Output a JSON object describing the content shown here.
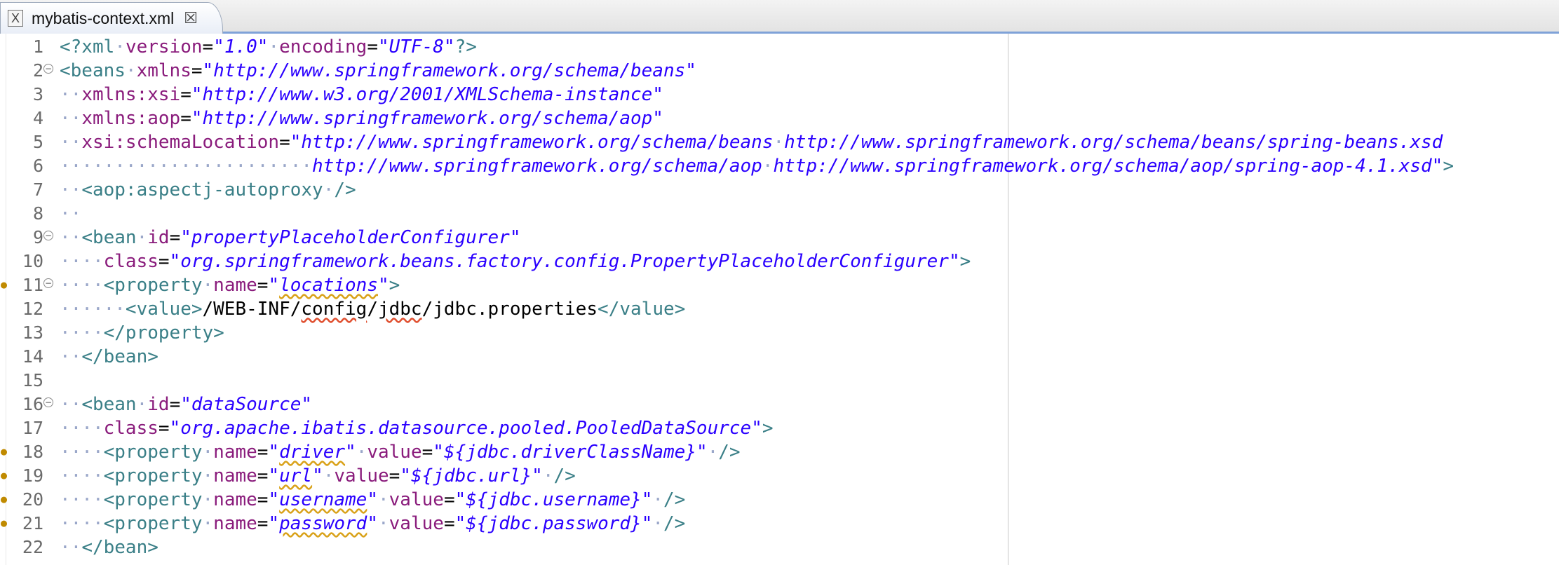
{
  "tab": {
    "title": "mybatis-context.xml",
    "icon": "xml-file-icon",
    "close_icon": "close-icon"
  },
  "editor": {
    "lines": [
      {
        "n": "1",
        "fold": false,
        "marker": false,
        "segs": [
          [
            "pi",
            "<?xml"
          ],
          [
            "d",
            "·"
          ],
          [
            "an",
            "version"
          ],
          [
            "tx",
            "="
          ],
          [
            "av",
            "\"1.0\""
          ],
          [
            "d",
            "·"
          ],
          [
            "an",
            "encoding"
          ],
          [
            "tx",
            "="
          ],
          [
            "av",
            "\"UTF-8\""
          ],
          [
            "pi",
            "?>"
          ]
        ]
      },
      {
        "n": "2",
        "fold": true,
        "marker": false,
        "segs": [
          [
            "tg",
            "<beans"
          ],
          [
            "d",
            "·"
          ],
          [
            "an",
            "xmlns"
          ],
          [
            "tx",
            "="
          ],
          [
            "av",
            "\"http://www.springframework.org/schema/beans\""
          ]
        ]
      },
      {
        "n": "3",
        "fold": false,
        "marker": false,
        "segs": [
          [
            "d",
            "··"
          ],
          [
            "an",
            "xmlns:xsi"
          ],
          [
            "tx",
            "="
          ],
          [
            "av",
            "\"http://www.w3.org/2001/XMLSchema-instance\""
          ]
        ]
      },
      {
        "n": "4",
        "fold": false,
        "marker": false,
        "segs": [
          [
            "d",
            "··"
          ],
          [
            "an",
            "xmlns:aop"
          ],
          [
            "tx",
            "="
          ],
          [
            "av",
            "\"http://www.springframework.org/schema/aop\""
          ]
        ]
      },
      {
        "n": "5",
        "fold": false,
        "marker": false,
        "segs": [
          [
            "d",
            "··"
          ],
          [
            "an",
            "xsi:schemaLocation"
          ],
          [
            "tx",
            "="
          ],
          [
            "av",
            "\"http://www.springframework.org/schema/beans"
          ],
          [
            "d",
            "·"
          ],
          [
            "av",
            "http://www.springframework.org/schema/beans/spring-beans.xsd"
          ]
        ]
      },
      {
        "n": "6",
        "fold": false,
        "marker": false,
        "segs": [
          [
            "d",
            "·······················"
          ],
          [
            "av",
            "http://www.springframework.org/schema/aop"
          ],
          [
            "d",
            "·"
          ],
          [
            "av",
            "http://www.springframework.org/schema/aop/spring-aop-4.1.xsd\""
          ],
          [
            "tg",
            ">"
          ]
        ]
      },
      {
        "n": "7",
        "fold": false,
        "marker": false,
        "segs": [
          [
            "d",
            "··"
          ],
          [
            "tg",
            "<aop:aspectj-autoproxy"
          ],
          [
            "d",
            "·"
          ],
          [
            "tg",
            "/>"
          ]
        ]
      },
      {
        "n": "8",
        "fold": false,
        "marker": false,
        "segs": [
          [
            "d",
            "··"
          ]
        ]
      },
      {
        "n": "9",
        "fold": true,
        "marker": false,
        "segs": [
          [
            "d",
            "··"
          ],
          [
            "tg",
            "<bean"
          ],
          [
            "d",
            "·"
          ],
          [
            "an",
            "id"
          ],
          [
            "tx",
            "="
          ],
          [
            "av",
            "\"propertyPlaceholderConfigurer\""
          ]
        ]
      },
      {
        "n": "10",
        "fold": false,
        "marker": false,
        "segs": [
          [
            "d",
            "····"
          ],
          [
            "an",
            "class"
          ],
          [
            "tx",
            "="
          ],
          [
            "av",
            "\"org.springframework.beans.factory.config.PropertyPlaceholderConfigurer\""
          ],
          [
            "tg",
            ">"
          ]
        ]
      },
      {
        "n": "11",
        "fold": true,
        "marker": true,
        "segs": [
          [
            "d",
            "····"
          ],
          [
            "tg",
            "<property"
          ],
          [
            "d",
            "·"
          ],
          [
            "an",
            "name"
          ],
          [
            "tx",
            "="
          ],
          [
            "av",
            "\""
          ],
          [
            "avs",
            "locations"
          ],
          [
            "av",
            "\""
          ],
          [
            "tg",
            ">"
          ]
        ]
      },
      {
        "n": "12",
        "fold": false,
        "marker": false,
        "segs": [
          [
            "d",
            "······"
          ],
          [
            "tg",
            "<value>"
          ],
          [
            "tx",
            "/WEB-INF/"
          ],
          [
            "txr",
            "config"
          ],
          [
            "tx",
            "/"
          ],
          [
            "txr",
            "jdbc"
          ],
          [
            "tx",
            "/jdbc.properties"
          ],
          [
            "tg",
            "</value>"
          ]
        ]
      },
      {
        "n": "13",
        "fold": false,
        "marker": false,
        "segs": [
          [
            "d",
            "····"
          ],
          [
            "tg",
            "</property>"
          ]
        ]
      },
      {
        "n": "14",
        "fold": false,
        "marker": false,
        "segs": [
          [
            "d",
            "··"
          ],
          [
            "tg",
            "</bean>"
          ]
        ]
      },
      {
        "n": "15",
        "fold": false,
        "marker": false,
        "segs": []
      },
      {
        "n": "16",
        "fold": true,
        "marker": false,
        "segs": [
          [
            "d",
            "··"
          ],
          [
            "tg",
            "<bean"
          ],
          [
            "d",
            "·"
          ],
          [
            "an",
            "id"
          ],
          [
            "tx",
            "="
          ],
          [
            "av",
            "\"dataSource\""
          ]
        ]
      },
      {
        "n": "17",
        "fold": false,
        "marker": false,
        "segs": [
          [
            "d",
            "····"
          ],
          [
            "an",
            "class"
          ],
          [
            "tx",
            "="
          ],
          [
            "av",
            "\"org.apache.ibatis.datasource.pooled.PooledDataSource\""
          ],
          [
            "tg",
            ">"
          ]
        ]
      },
      {
        "n": "18",
        "fold": false,
        "marker": true,
        "segs": [
          [
            "d",
            "····"
          ],
          [
            "tg",
            "<property"
          ],
          [
            "d",
            "·"
          ],
          [
            "an",
            "name"
          ],
          [
            "tx",
            "="
          ],
          [
            "av",
            "\""
          ],
          [
            "avs",
            "driver"
          ],
          [
            "av",
            "\""
          ],
          [
            "d",
            "·"
          ],
          [
            "an",
            "value"
          ],
          [
            "tx",
            "="
          ],
          [
            "av",
            "\"${jdbc.driverClassName}\""
          ],
          [
            "d",
            "·"
          ],
          [
            "tg",
            "/>"
          ]
        ]
      },
      {
        "n": "19",
        "fold": false,
        "marker": true,
        "segs": [
          [
            "d",
            "····"
          ],
          [
            "tg",
            "<property"
          ],
          [
            "d",
            "·"
          ],
          [
            "an",
            "name"
          ],
          [
            "tx",
            "="
          ],
          [
            "av",
            "\""
          ],
          [
            "avs",
            "url"
          ],
          [
            "av",
            "\""
          ],
          [
            "d",
            "·"
          ],
          [
            "an",
            "value"
          ],
          [
            "tx",
            "="
          ],
          [
            "av",
            "\"${jdbc.url}\""
          ],
          [
            "d",
            "·"
          ],
          [
            "tg",
            "/>"
          ]
        ]
      },
      {
        "n": "20",
        "fold": false,
        "marker": true,
        "segs": [
          [
            "d",
            "····"
          ],
          [
            "tg",
            "<property"
          ],
          [
            "d",
            "·"
          ],
          [
            "an",
            "name"
          ],
          [
            "tx",
            "="
          ],
          [
            "av",
            "\""
          ],
          [
            "avs",
            "username"
          ],
          [
            "av",
            "\""
          ],
          [
            "d",
            "·"
          ],
          [
            "an",
            "value"
          ],
          [
            "tx",
            "="
          ],
          [
            "av",
            "\"${jdbc.username}\""
          ],
          [
            "d",
            "·"
          ],
          [
            "tg",
            "/>"
          ]
        ]
      },
      {
        "n": "21",
        "fold": false,
        "marker": true,
        "segs": [
          [
            "d",
            "····"
          ],
          [
            "tg",
            "<property"
          ],
          [
            "d",
            "·"
          ],
          [
            "an",
            "name"
          ],
          [
            "tx",
            "="
          ],
          [
            "av",
            "\""
          ],
          [
            "avs",
            "password"
          ],
          [
            "av",
            "\""
          ],
          [
            "d",
            "·"
          ],
          [
            "an",
            "value"
          ],
          [
            "tx",
            "="
          ],
          [
            "av",
            "\"${jdbc.password}\""
          ],
          [
            "d",
            "·"
          ],
          [
            "tg",
            "/>"
          ]
        ]
      },
      {
        "n": "22",
        "fold": false,
        "marker": false,
        "segs": [
          [
            "d",
            "··"
          ],
          [
            "tg",
            "</bean>"
          ]
        ]
      }
    ],
    "colors": {
      "tag": "#3a7f87",
      "attr_name": "#8a1c7c",
      "attr_value": "#2a00ff",
      "whitespace_marker": "#9aa7c9",
      "text": "#000000"
    }
  }
}
